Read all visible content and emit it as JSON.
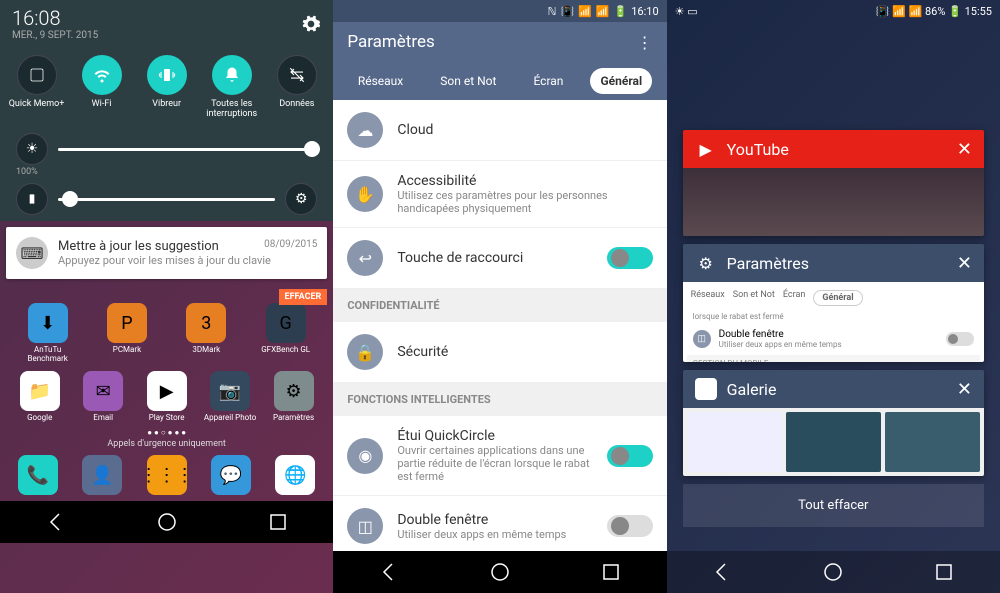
{
  "panel1": {
    "time": "16:08",
    "date": "MER., 9 SEPT. 2015",
    "quick_settings": [
      {
        "label": "Quick Memo+",
        "icon": "memo",
        "on": false
      },
      {
        "label": "Wi-Fi",
        "icon": "wifi",
        "on": true
      },
      {
        "label": "Vibreur",
        "icon": "vibrate",
        "on": true
      },
      {
        "label": "Toutes les interruptions",
        "icon": "bell",
        "on": true
      },
      {
        "label": "Données",
        "icon": "data",
        "on": false
      }
    ],
    "brightness_pct": "100%",
    "notification": {
      "title": "Mettre à jour les suggestion",
      "sub": "Appuyez pour voir les mises à jour du clavie",
      "date": "08/09/2015"
    },
    "clear_label": "EFFACER",
    "apps_row1": [
      {
        "label": "AnTuTu Benchmark",
        "color": "#3498db"
      },
      {
        "label": "PCMark",
        "color": "#e67e22"
      },
      {
        "label": "3DMark",
        "color": "#e67e22"
      },
      {
        "label": "GFXBench GL",
        "color": "#2c3e50"
      }
    ],
    "apps_row2": [
      {
        "label": "Google",
        "color": "#fff"
      },
      {
        "label": "Email",
        "color": "#9b59b6"
      },
      {
        "label": "Play Store",
        "color": "#fff"
      },
      {
        "label": "Appareil Photo",
        "color": "#34495e"
      },
      {
        "label": "Paramètres",
        "color": "#7f8c8d"
      }
    ],
    "emergency": "Appels d'urgence uniquement",
    "dock": [
      {
        "color": "#1dd1c6"
      },
      {
        "color": "#5a6c8f"
      },
      {
        "color": "#f39c12"
      },
      {
        "color": "#3498db"
      },
      {
        "color": "#fff"
      }
    ]
  },
  "panel2": {
    "status_time": "16:10",
    "title": "Paramètres",
    "tabs": [
      "Réseaux",
      "Son et Not",
      "Écran",
      "Général"
    ],
    "active_tab": 3,
    "items": [
      {
        "title": "Cloud",
        "icon": "cloud"
      },
      {
        "title": "Accessibilité",
        "sub": "Utilisez ces paramètres pour les personnes handicapées physiquement",
        "icon": "accessibility"
      },
      {
        "title": "Touche de raccourci",
        "icon": "shortcut",
        "toggle": true
      }
    ],
    "section_privacy": "CONFIDENTIALITÉ",
    "security": {
      "title": "Sécurité",
      "icon": "lock"
    },
    "section_smart": "FONCTIONS INTELLIGENTES",
    "quickcircle": {
      "title": "Étui QuickCircle",
      "sub": "Ouvrir certaines applications dans une partie réduite de l'écran lorsque le rabat est fermé",
      "toggle": true
    },
    "dualwindow": {
      "title": "Double fenêtre",
      "sub": "Utiliser deux apps en même temps",
      "toggle": false
    }
  },
  "panel3": {
    "status_battery": "86%",
    "status_time": "15:55",
    "cards": {
      "youtube": {
        "title": "YouTube"
      },
      "settings": {
        "title": "Paramètres",
        "tabs": [
          "Réseaux",
          "Son et Not",
          "Écran",
          "Général"
        ],
        "item_sub": "lorsque le rabat est fermé",
        "dual_title": "Double fenêtre",
        "dual_sub": "Utiliser deux apps en même temps",
        "section": "GESTION DU MOBILE"
      },
      "gallery": {
        "title": "Galerie"
      }
    },
    "clear_all": "Tout effacer"
  }
}
